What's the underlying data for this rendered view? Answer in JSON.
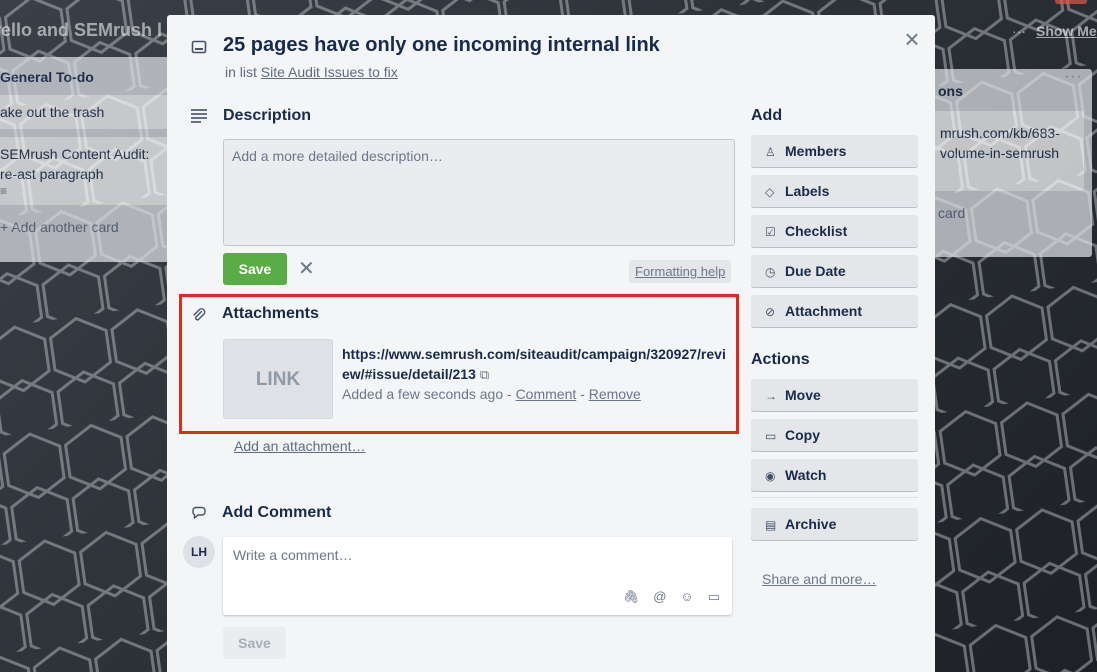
{
  "board": {
    "title": "rello and SEMrush l",
    "show_menu_dots": "···",
    "show_menu_label": "Show Me",
    "left_list": {
      "title": "General To-do",
      "cards": [
        "ake out the trash",
        "SEMrush Content Audit: re-ast paragraph"
      ],
      "add_card": "+ Add another card"
    },
    "right_list": {
      "title": "ons",
      "card": "mrush.com/kb/683-volume-in-semrush",
      "add_card": "card",
      "dots": "···"
    }
  },
  "card": {
    "title": "25 pages have only one incoming internal link",
    "in_list_prefix": "in list",
    "list_name": "Site Audit Issues to fix",
    "description": {
      "heading": "Description",
      "placeholder": "Add a more detailed description…",
      "save_label": "Save",
      "formatting_help": "Formatting help"
    },
    "attachments": {
      "heading": "Attachments",
      "thumb_label": "LINK",
      "url": "https://www.semrush.com/siteaudit/campaign/320927/review/#issue/detail/213",
      "added": "Added a few seconds ago -",
      "comment_link": "Comment",
      "sep": "-",
      "remove_link": "Remove",
      "add_link": "Add an attachment…"
    },
    "comment": {
      "heading": "Add Comment",
      "avatar_initials": "LH",
      "placeholder": "Write a comment…",
      "save_label": "Save"
    }
  },
  "sidebar": {
    "add_heading": "Add",
    "add_items": [
      {
        "label": "Members",
        "icon": "person-icon"
      },
      {
        "label": "Labels",
        "icon": "tag-icon"
      },
      {
        "label": "Checklist",
        "icon": "checkbox-icon"
      },
      {
        "label": "Due Date",
        "icon": "clock-icon"
      },
      {
        "label": "Attachment",
        "icon": "paperclip-icon"
      }
    ],
    "actions_heading": "Actions",
    "action_items": [
      {
        "label": "Move",
        "icon": "arrow-right-icon"
      },
      {
        "label": "Copy",
        "icon": "card-icon"
      },
      {
        "label": "Watch",
        "icon": "eye-icon"
      },
      {
        "label": "Archive",
        "icon": "archive-icon"
      }
    ],
    "share_link": "Share and more…"
  },
  "colors": {
    "save_green": "#5aac44",
    "highlight_red": "#e2291c",
    "modal_bg": "#f4f5f7"
  }
}
